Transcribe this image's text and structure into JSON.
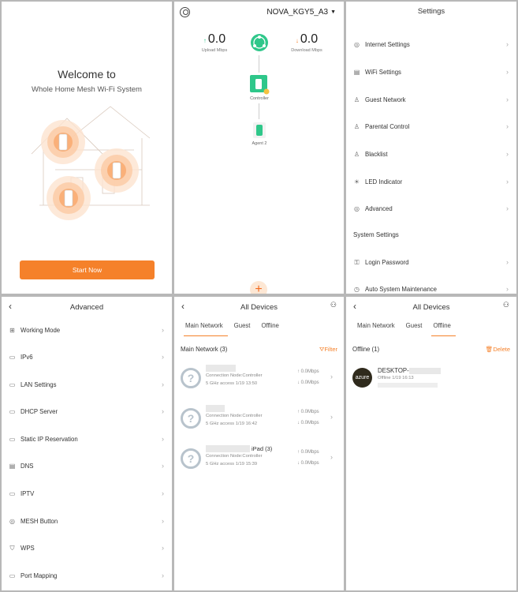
{
  "welcome": {
    "title": "Welcome to",
    "subtitle": "Whole Home Mesh Wi-Fi System",
    "start_button": "Start Now"
  },
  "topology": {
    "network_name": "NOVA_KGY5_A3",
    "upload_value": "0.0",
    "upload_label": "Upload Mbps",
    "download_value": "0.0",
    "download_label": "Download Mbps",
    "controller_label": "Controller",
    "agent_label": "Agent 2"
  },
  "settings": {
    "title": "Settings",
    "items": [
      {
        "label": "Internet Settings",
        "icon": "globe-icon"
      },
      {
        "label": "WiFi Settings",
        "icon": "wifi-icon"
      },
      {
        "label": "Guest Network",
        "icon": "guest-icon"
      },
      {
        "label": "Parental Control",
        "icon": "parental-icon"
      },
      {
        "label": "Blacklist",
        "icon": "blacklist-icon"
      },
      {
        "label": "LED Indicator",
        "icon": "led-icon"
      },
      {
        "label": "Advanced",
        "icon": "advanced-icon"
      }
    ],
    "system_header": "System Settings",
    "system_items": [
      {
        "label": "Login Password",
        "icon": "lock-icon"
      },
      {
        "label": "Auto System Maintenance",
        "icon": "clock-icon"
      }
    ]
  },
  "advanced": {
    "title": "Advanced",
    "items": [
      {
        "label": "Working Mode"
      },
      {
        "label": "IPv6"
      },
      {
        "label": "LAN Settings"
      },
      {
        "label": "DHCP Server"
      },
      {
        "label": "Static IP Reservation"
      },
      {
        "label": "DNS"
      },
      {
        "label": "IPTV"
      },
      {
        "label": "MESH Button"
      },
      {
        "label": "WPS"
      },
      {
        "label": "Port Mapping"
      }
    ]
  },
  "all_devices": {
    "title": "All Devices",
    "tabs": [
      "Main Network",
      "Guest",
      "Offline"
    ],
    "section_label": "Main Network (3)",
    "filter_label": "Filter",
    "devices": [
      {
        "name": "",
        "connection": "Connection Node:Controller",
        "access": "5 GHz access   1/19 13:50",
        "up": "0.0Mbps",
        "down": "0.0Mbps"
      },
      {
        "name": "",
        "connection": "Connection Node:Controller",
        "access": "5 GHz access   1/19 16:42",
        "up": "0.0Mbps",
        "down": "0.0Mbps"
      },
      {
        "name": "iPad (3)",
        "connection": "Connection Node:Controller",
        "access": "5 GHz access   1/19 15:39",
        "up": "0.0Mbps",
        "down": "0.0Mbps"
      }
    ]
  },
  "offline_devices": {
    "title": "All Devices",
    "tabs": [
      "Main Network",
      "Guest",
      "Offline"
    ],
    "section_label": "Offline (1)",
    "delete_label": "Delete",
    "device": {
      "avatar": "azure",
      "name": "DESKTOP-",
      "status": "Offline   1/19 16:13"
    }
  },
  "colors": {
    "accent": "#f5812a",
    "green": "#2fc78a"
  }
}
